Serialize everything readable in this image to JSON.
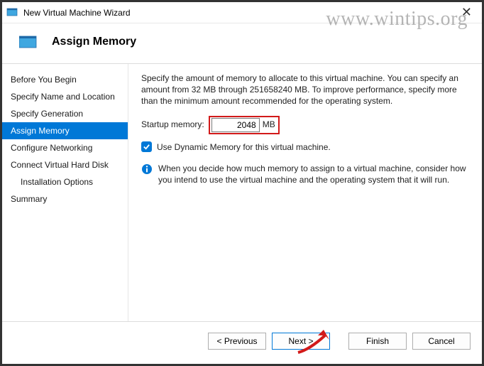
{
  "window": {
    "title": "New Virtual Machine Wizard"
  },
  "watermark": "www.wintips.org",
  "header": {
    "title": "Assign Memory"
  },
  "sidebar": {
    "items": [
      {
        "label": "Before You Begin"
      },
      {
        "label": "Specify Name and Location"
      },
      {
        "label": "Specify Generation"
      },
      {
        "label": "Assign Memory"
      },
      {
        "label": "Configure Networking"
      },
      {
        "label": "Connect Virtual Hard Disk"
      },
      {
        "label": "Installation Options"
      },
      {
        "label": "Summary"
      }
    ]
  },
  "content": {
    "description": "Specify the amount of memory to allocate to this virtual machine. You can specify an amount from 32 MB through 251658240 MB. To improve performance, specify more than the minimum amount recommended for the operating system.",
    "startup_label": "Startup memory:",
    "startup_value": "2048",
    "startup_unit": "MB",
    "dynamic_label": "Use Dynamic Memory for this virtual machine.",
    "info_text": "When you decide how much memory to assign to a virtual machine, consider how you intend to use the virtual machine and the operating system that it will run."
  },
  "footer": {
    "previous": "< Previous",
    "next": "Next >",
    "finish": "Finish",
    "cancel": "Cancel"
  }
}
